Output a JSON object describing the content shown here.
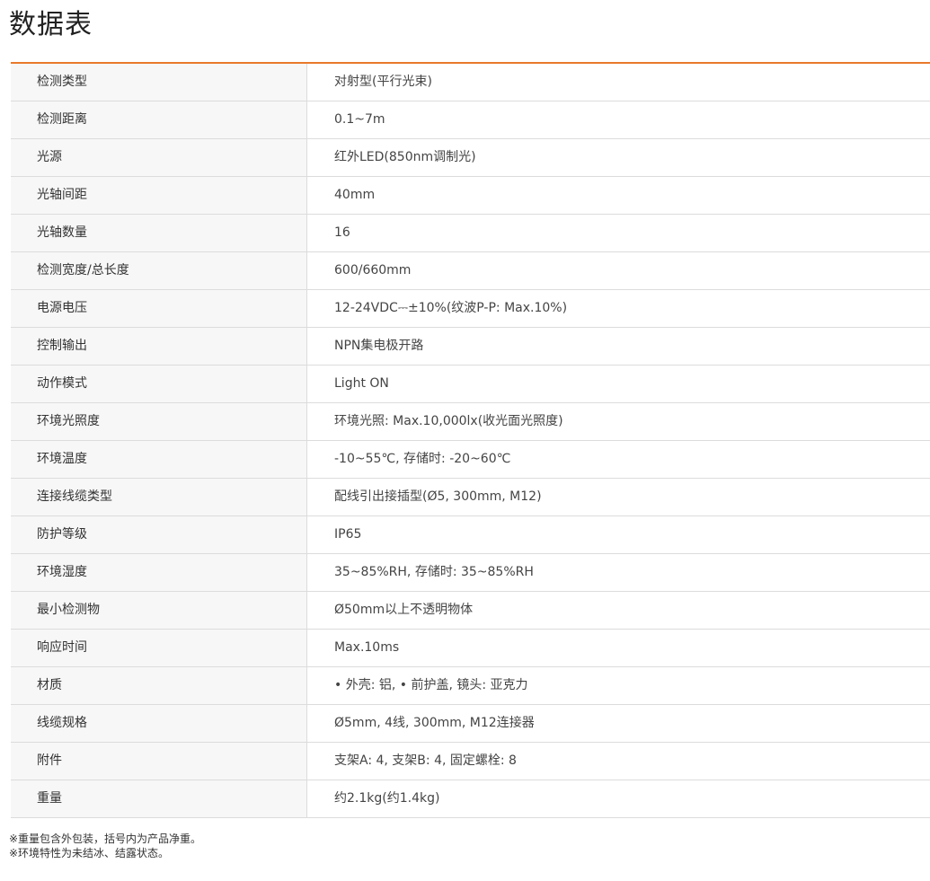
{
  "page": {
    "title": "数据表"
  },
  "colors": {
    "accent": "#e8792b",
    "label_background": "#f7f7f7",
    "border": "#dcdcdc"
  },
  "spec_rows": [
    {
      "label": "检测类型",
      "value": "对射型(平行光束)"
    },
    {
      "label": "检测距离",
      "value": "0.1~7m"
    },
    {
      "label": "光源",
      "value": "红外LED(850nm调制光)"
    },
    {
      "label": "光轴间距",
      "value": "40mm"
    },
    {
      "label": "光轴数量",
      "value": "16"
    },
    {
      "label": "检测宽度/总长度",
      "value": "600/660mm"
    },
    {
      "label": "电源电压",
      "value": "12-24VDC⎓±10%(纹波P-P: Max.10%)"
    },
    {
      "label": "控制输出",
      "value": "NPN集电极开路"
    },
    {
      "label": "动作模式",
      "value": "Light ON"
    },
    {
      "label": "环境光照度",
      "value": "环境光照: Max.10,000lx(收光面光照度)"
    },
    {
      "label": "环境温度",
      "value": "-10~55℃, 存储时: -20~60℃"
    },
    {
      "label": "连接线缆类型",
      "value": "配线引出接插型(Ø5, 300mm, M12)"
    },
    {
      "label": "防护等级",
      "value": "IP65"
    },
    {
      "label": "环境湿度",
      "value": "35~85%RH, 存储时: 35~85%RH"
    },
    {
      "label": "最小检测物",
      "value": "Ø50mm以上不透明物体"
    },
    {
      "label": "响应时间",
      "value": "Max.10ms"
    },
    {
      "label": "材质",
      "value": "• 外壳: 铝, • 前护盖, 镜头: 亚克力"
    },
    {
      "label": "线缆规格",
      "value": "Ø5mm, 4线, 300mm, M12连接器"
    },
    {
      "label": "附件",
      "value": "支架A: 4, 支架B: 4, 固定螺栓: 8"
    },
    {
      "label": "重量",
      "value": "约2.1kg(约1.4kg)"
    }
  ],
  "notes": [
    "※重量包含外包装，括号内为产品净重。",
    "※环境特性为未结冰、结露状态。"
  ]
}
